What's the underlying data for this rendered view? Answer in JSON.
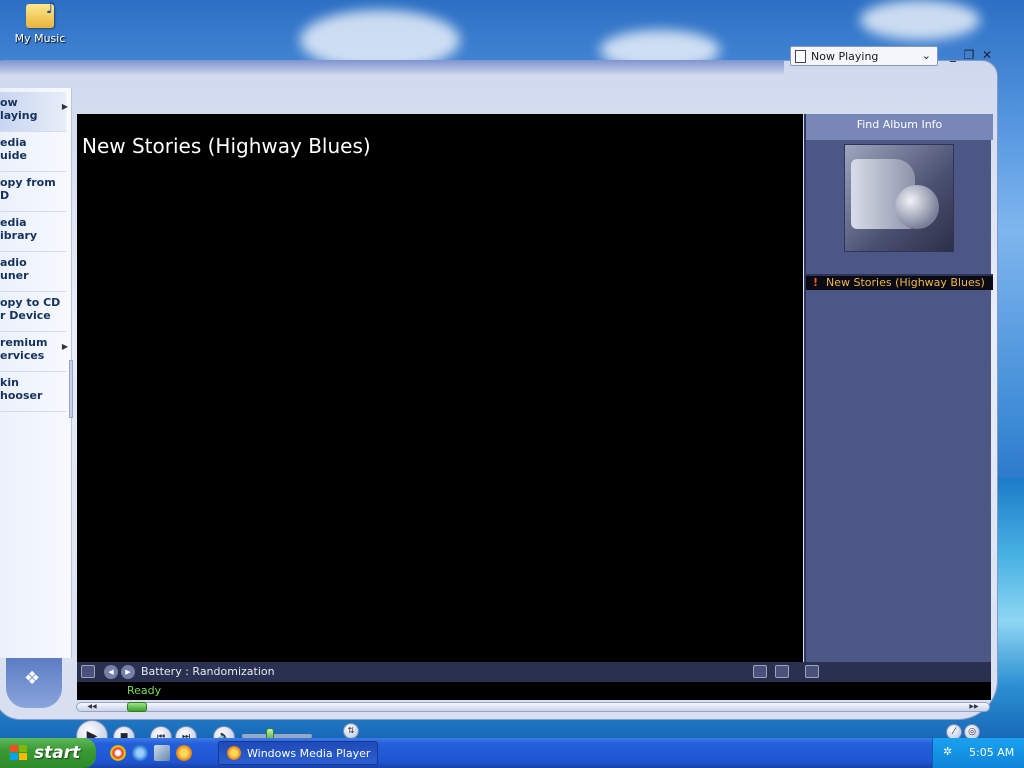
{
  "desktop": {
    "icon_label": "My Music"
  },
  "window": {
    "view_selector": "Now Playing",
    "controls": {
      "minimize": "_",
      "restore": "❐",
      "close": "✕"
    }
  },
  "sidebar": {
    "items": [
      {
        "line1": "ow",
        "line2": "laying"
      },
      {
        "line1": "edia",
        "line2": "uide"
      },
      {
        "line1": "opy from",
        "line2": "D"
      },
      {
        "line1": "edia",
        "line2": "ibrary"
      },
      {
        "line1": "adio",
        "line2": "uner"
      },
      {
        "line1": "opy to CD",
        "line2": "r Device"
      },
      {
        "line1": "remium",
        "line2": "ervices"
      },
      {
        "line1": "kin",
        "line2": "hooser"
      }
    ]
  },
  "video": {
    "title": "New Stories (Highway Blues)"
  },
  "playlist": {
    "header": "Find Album Info",
    "items": [
      {
        "title": "New Stories (Highway Blues)",
        "marker": "!"
      }
    ]
  },
  "infobar": {
    "text": "Battery : Randomization"
  },
  "status": {
    "text": "Ready"
  },
  "playback": {
    "progress_fraction": 0.03,
    "volume_fraction": 0.38
  },
  "taskbar": {
    "start_label": "start",
    "task_label": "Windows Media Player",
    "clock": "5:05 AM"
  },
  "colors": {
    "status_text": "#7ed957",
    "playlist_item": "#f2b84b",
    "playlist_bg": "#4c5786"
  }
}
